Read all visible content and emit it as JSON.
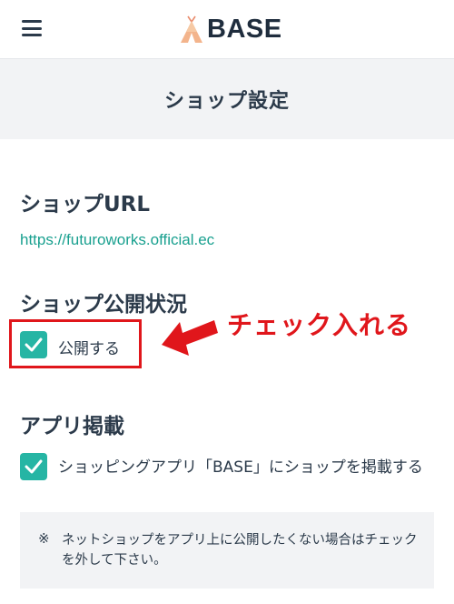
{
  "header": {
    "logo_text": "BASE",
    "menu_icon": "hamburger-menu-icon"
  },
  "page": {
    "title": "ショップ設定"
  },
  "shop_url": {
    "heading": "ショップURL",
    "url": "https://futuroworks.official.ec"
  },
  "publish_status": {
    "heading": "ショップ公開状況",
    "checkbox_label": "公開する",
    "checked": true
  },
  "annotation": {
    "text": "チェック入れる",
    "color": "#e0161b"
  },
  "app_listing": {
    "heading": "アプリ掲載",
    "checkbox_label": "ショッピングアプリ「BASE」にショップを掲載する",
    "checked": true
  },
  "note": {
    "mark": "※",
    "text": "ネットショップをアプリ上に公開したくない場合はチェックを外して下さい。"
  },
  "colors": {
    "accent": "#26b5a4",
    "link": "#19a08f",
    "text": "#2b3a4a",
    "panel": "#f2f3f5"
  }
}
